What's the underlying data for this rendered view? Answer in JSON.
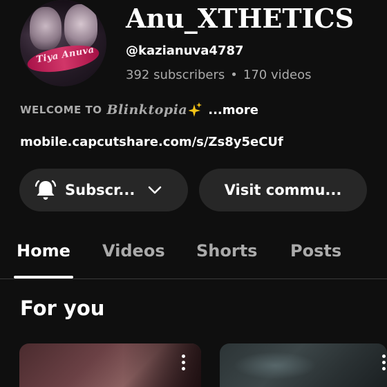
{
  "channel": {
    "avatar_text": "Tiya  Anuva",
    "name": "Anu_XTHETICS",
    "handle": "@kazianuva4787",
    "subscribers": "392 subscribers",
    "separator": "•",
    "videos": "170 videos",
    "description_welcome": "WELCOME TO",
    "description_brand": "Blinktopia",
    "description_more": "...more",
    "link": "mobile.capcutshare.com/s/Zs8y5eCUf"
  },
  "buttons": {
    "subscribe_label": "Subscr...",
    "community_label": "Visit commu..."
  },
  "tabs": [
    {
      "label": "Home",
      "active": true
    },
    {
      "label": "Videos",
      "active": false
    },
    {
      "label": "Shorts",
      "active": false
    },
    {
      "label": "Posts",
      "active": false
    }
  ],
  "section": {
    "title": "For you"
  },
  "icons": {
    "subscribe": "bell-icon",
    "dropdown": "chevron-down-icon",
    "card_menu": "more-vert-icon",
    "description_emoji": "sparkles-icon"
  },
  "colors": {
    "background": "#0f0f0f",
    "button_bg": "#272727",
    "secondary_text": "#aaaaaa",
    "sparkle": "#f5c518"
  }
}
